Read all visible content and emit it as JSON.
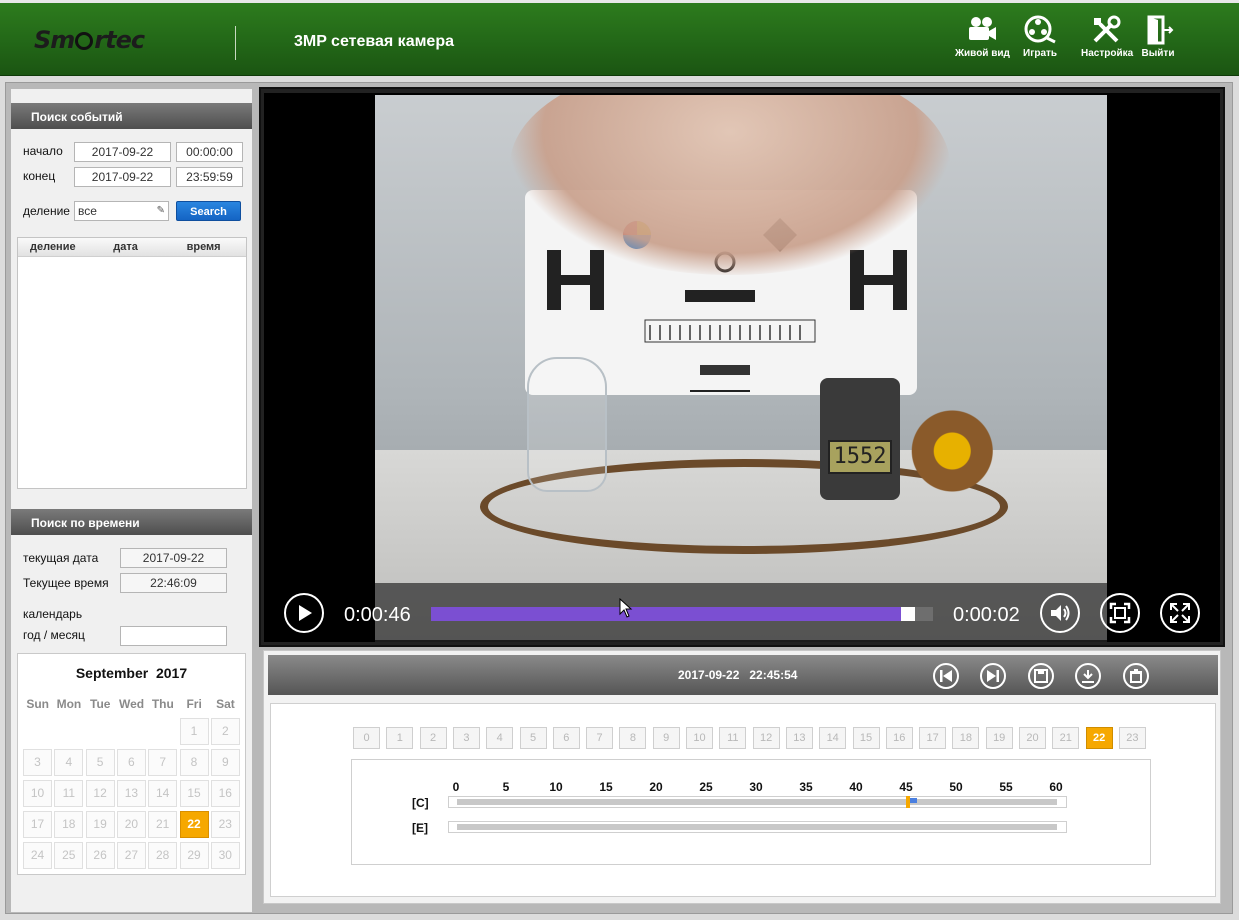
{
  "header": {
    "logo_text": "Smartec",
    "camera_title": "3MP сетевая камера",
    "nav": [
      {
        "label": "Живой вид",
        "icon": "video-camera-icon"
      },
      {
        "label": "Играть",
        "icon": "film-reel-icon"
      },
      {
        "label": "Настройка",
        "icon": "tools-icon"
      },
      {
        "label": "Выйти",
        "icon": "exit-door-icon"
      }
    ]
  },
  "event_search": {
    "title": "Поиск событий",
    "start_label": "начало",
    "start_date": "2017-09-22",
    "start_time": "00:00:00",
    "end_label": "конец",
    "end_date": "2017-09-22",
    "end_time": "23:59:59",
    "division_label": "деление",
    "division_value": "все",
    "search_button": "Search",
    "columns": [
      "деление",
      "дата",
      "время"
    ]
  },
  "time_search": {
    "title": "Поиск по времени",
    "current_date_label": "текущая дата",
    "current_date": "2017-09-22",
    "current_time_label": "Текущее время",
    "current_time": "22:46:09",
    "calendar_label": "календарь",
    "year_month_label": "год / месяц",
    "year_month_value": ""
  },
  "calendar": {
    "month": "September",
    "year": "2017",
    "weekdays": [
      "Sun",
      "Mon",
      "Tue",
      "Wed",
      "Thu",
      "Fri",
      "Sat"
    ],
    "days": [
      {
        "d": "1",
        "col": 5,
        "row": 0
      },
      {
        "d": "2",
        "col": 6,
        "row": 0
      },
      {
        "d": "3",
        "col": 0,
        "row": 1
      },
      {
        "d": "4",
        "col": 1,
        "row": 1
      },
      {
        "d": "5",
        "col": 2,
        "row": 1
      },
      {
        "d": "6",
        "col": 3,
        "row": 1
      },
      {
        "d": "7",
        "col": 4,
        "row": 1
      },
      {
        "d": "8",
        "col": 5,
        "row": 1
      },
      {
        "d": "9",
        "col": 6,
        "row": 1
      },
      {
        "d": "10",
        "col": 0,
        "row": 2
      },
      {
        "d": "11",
        "col": 1,
        "row": 2
      },
      {
        "d": "12",
        "col": 2,
        "row": 2
      },
      {
        "d": "13",
        "col": 3,
        "row": 2
      },
      {
        "d": "14",
        "col": 4,
        "row": 2
      },
      {
        "d": "15",
        "col": 5,
        "row": 2
      },
      {
        "d": "16",
        "col": 6,
        "row": 2
      },
      {
        "d": "17",
        "col": 0,
        "row": 3
      },
      {
        "d": "18",
        "col": 1,
        "row": 3
      },
      {
        "d": "19",
        "col": 2,
        "row": 3
      },
      {
        "d": "20",
        "col": 3,
        "row": 3
      },
      {
        "d": "21",
        "col": 4,
        "row": 3
      },
      {
        "d": "22",
        "col": 5,
        "row": 3
      },
      {
        "d": "23",
        "col": 6,
        "row": 3
      },
      {
        "d": "24",
        "col": 0,
        "row": 4
      },
      {
        "d": "25",
        "col": 1,
        "row": 4
      },
      {
        "d": "26",
        "col": 2,
        "row": 4
      },
      {
        "d": "27",
        "col": 3,
        "row": 4
      },
      {
        "d": "28",
        "col": 4,
        "row": 4
      },
      {
        "d": "29",
        "col": 5,
        "row": 4
      },
      {
        "d": "30",
        "col": 6,
        "row": 4
      }
    ],
    "selected_day": "22"
  },
  "player": {
    "elapsed": "0:00:46",
    "remaining": "0:00:02",
    "progress": 0.95,
    "lcd_reading": "1552"
  },
  "playback_bar": {
    "datetime": "2017-09-22   22:45:54",
    "buttons": [
      "skip-previous-icon",
      "skip-next-icon",
      "save-icon",
      "download-icon",
      "delete-icon"
    ]
  },
  "timeline": {
    "hours": [
      "0",
      "1",
      "2",
      "3",
      "4",
      "5",
      "6",
      "7",
      "8",
      "9",
      "10",
      "11",
      "12",
      "13",
      "14",
      "15",
      "16",
      "17",
      "18",
      "19",
      "20",
      "21",
      "22",
      "23"
    ],
    "active_hour": "22",
    "ticks": [
      "0",
      "5",
      "10",
      "15",
      "20",
      "25",
      "30",
      "35",
      "40",
      "45",
      "50",
      "55",
      "60"
    ],
    "tracks": [
      "[C]",
      "[E]"
    ],
    "marker_minute": 45.1,
    "recording_minutes": [
      45.2,
      46.0
    ]
  }
}
